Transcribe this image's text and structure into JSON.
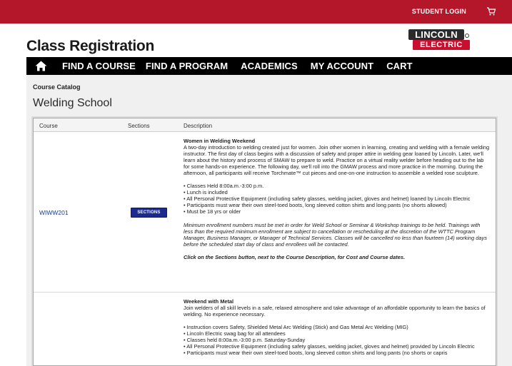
{
  "header": {
    "student_login": "STUDENT LOGIN",
    "cart_icon": "cart-icon",
    "brand_color": "#b5172a"
  },
  "page_title": "Class Registration",
  "logo": {
    "line1": "LINCOLN",
    "line2": "ELECTRIC"
  },
  "nav": {
    "home_icon": "home-icon",
    "items": [
      "FIND A COURSE",
      "FIND A PROGRAM",
      "ACADEMICS",
      "MY ACCOUNT",
      "CART"
    ]
  },
  "breadcrumb": "Course Catalog",
  "section_title": "Welding School",
  "table": {
    "headers": {
      "course": "Course",
      "sections": "Sections",
      "description": "Description"
    },
    "rows": [
      {
        "code": "WIWW201",
        "button": "SECTIONS",
        "title": "Women in Welding Weekend",
        "intro": "A two-day introduction to welding created just for women. Join other women in learning, creating and welding with a female welding instructor. The first day of class begins with a discussion of safety and proper attire in welding gear loaned by Lincoln. Later, we'll learn about the history and process of SMAW to prepare to weld. Practice on a virtual reality welder before heading out to the lab for some hands-on experience. The following day, we'll roll into the GMAW process and more practice in the morning. During the afternoon, all participants will receive Torchmate™ cut pieces and one-on-one instruction to assemble a welded rose sculpture.",
        "bullets": [
          "• Classes Held 8:00a.m.-3:00 p.m.",
          "• Lunch is included",
          "• All Personal Protective Equipment (including safety glasses, welding jacket, gloves and helmet) loaned by Lincoln Electric",
          "• Participants must wear their own steel-toed boots, long sleeved cotton shirts and long pants (no shorts allowed)",
          "• Must be 18 yrs or older"
        ],
        "note": "Minimum enrollment numbers must be met in order for Weld School or Seminar & Workshop trainings to be held. Trainings with less than the required minimum enrollment are subject to cancellation or rescheduling at the discretion of the WTTC Program Manager, Business Manager, or Manager of Technical Services. Classes will be cancelled no less than fourteen (14) working days before the scheduled start day of class and enrollees will be contacted.",
        "cta": "Click on the Sections button, next to the Course Description, for Cost and Course dates."
      },
      {
        "title": "Weekend with Metal",
        "intro": "Join welders of all skill levels in a safe, relaxed atmosphere and take advantage of an affordable opportunity to learn the basics of welding. No experience necessary.",
        "bullets": [
          "• Instruction covers Safety, Shielded Metal Arc Welding (Stick) and Gas Metal Arc Welding (MIG)",
          "• Lincoln Electric swag bag for all attendees",
          "• Classes held 8:00a.m.-3:00 p.m. Saturday-Sunday",
          "• All Personal Protective Equipment (including safety glasses, welding jacket, gloves and helmet) provided by Lincoln Electric",
          "• Participants must wear their own steel-toed boots, long sleeved cotton shirts and long pants (no shorts or capris"
        ]
      }
    ]
  }
}
